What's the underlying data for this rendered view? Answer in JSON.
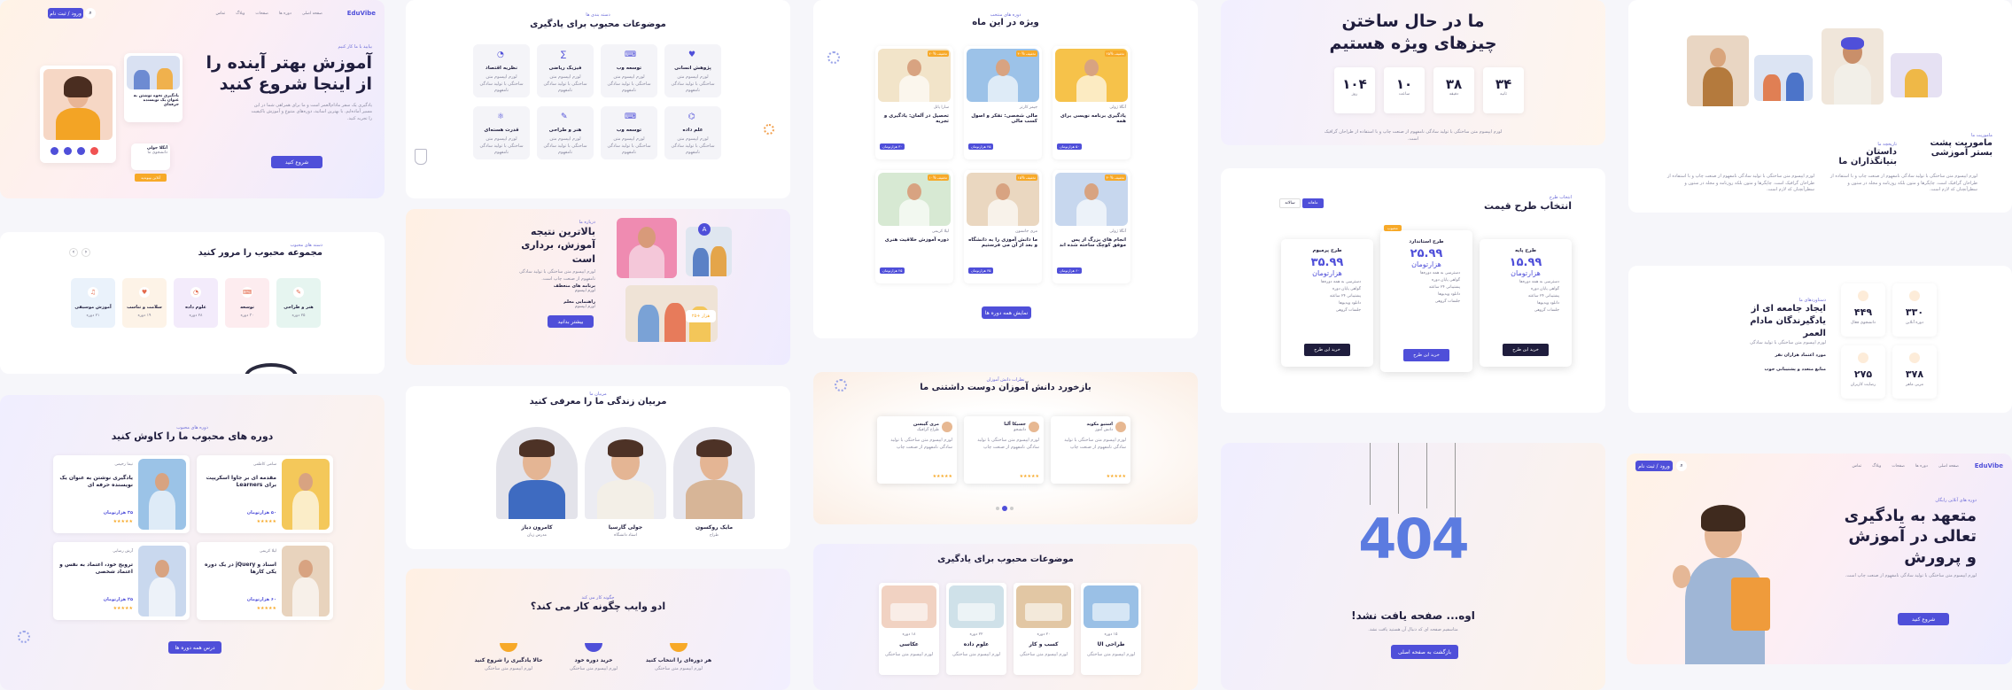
{
  "panel1": {
    "brand": "EduVibe",
    "nav": [
      "صفحه اصلی",
      "دوره ها",
      "صفحات",
      "وبلاگ",
      "تماس"
    ],
    "cta": "ورود / ثبت نام",
    "badge": "بیایید با ما کار کنیم",
    "title": "آموزش بهتر آینده را از اینجا شروع کنید",
    "desc": "یادگیری یک سفر مادام‌العمر است و ما برای همراهی شما در این مسیر آماده‌ایم. با بهترین اساتید، دوره‌های متنوع و آموزش باکیفیت را تجربه کنید.",
    "button": "شروع کنید",
    "mini_card_title": "یادگیری نحوه نوشتن به عنوان یک نویسنده حرفه‌ای",
    "person": "آنگلا جولی",
    "person_role": "دانشجوی ما",
    "join": "آنلاین بپیوندید"
  },
  "panel2": {
    "title": "موضوعات محبوب برای یادگیری",
    "subtitle": "دسته بندی ها",
    "topics": [
      "پژوهش انسانی",
      "توسعه وب",
      "فیزیک ریاضی",
      "نظریه اقتصاد",
      "علم داده",
      "توسعه وب",
      "هنر و طراحی",
      "قدرت هسته‌ای"
    ],
    "topic_desc": "لورم ایپسوم متن ساختگی با تولید سادگی نامفهوم"
  },
  "panel3": {
    "subtitle": "دوره های منتخب",
    "title": "ویژه در این ماه",
    "courses": [
      {
        "title": "یادگیری برنامه نویسی برای همه",
        "author": "آنگلا ژولی",
        "price": "۵۰ هزارتومان",
        "tag": "۲۵% تخفیف"
      },
      {
        "title": "مالی شخصی: تفکر و اصول کسب مالی",
        "author": "جیمز کارتر",
        "price": "۴۵ هزارتومان",
        "tag": "۴۰% تخفیف"
      },
      {
        "title": "تحصیل در آلمان: یادگیری و تجربه",
        "author": "سارا پاتل",
        "price": "۳۰ هزارتومان",
        "tag": "۲۰% تخفیف"
      },
      {
        "title": "انجام های بزرگ از پس موفق کوچک ساخته شده اند",
        "author": "آنگلا ژولی",
        "price": "۶۰ هزارتومان",
        "tag": "۳۰% تخفیف"
      },
      {
        "title": "ما دانش آموزی را به دانشگاه و بعد از آن می فرستیم",
        "author": "مری جانسون",
        "price": "۳۵ هزارتومان",
        "tag": "۱۵% تخفیف"
      },
      {
        "title": "دوره آموزش خلاقیت هنری",
        "author": "لیلا کریمی",
        "price": "۲۵ هزارتومان",
        "tag": "۱۰% تخفیف"
      }
    ],
    "button": "نمایش همه دوره ها"
  },
  "panel4": {
    "title": "ما در حال ساختن چیزهای ویژه هستیم",
    "countdown": [
      {
        "value": "۳۴",
        "label": "ثانیه"
      },
      {
        "value": "۳۸",
        "label": "دقیقه"
      },
      {
        "value": "۱۰",
        "label": "ساعت"
      },
      {
        "value": "۱۰۴",
        "label": "روز"
      }
    ],
    "desc": "لورم ایپسوم متن ساختگی با تولید سادگی نامفهوم از صنعت چاپ و با استفاده از طراحان گرافیک است."
  },
  "panel5": {
    "images_caption": "",
    "title1": "ماموریت پشت بستر آموزشی",
    "sub1": "ماموریت ما",
    "title2": "داستان بنیانگذاران ما",
    "sub2": "تاریخچه ما",
    "desc": "لورم ایپسوم متن ساختگی با تولید سادگی نامفهوم از صنعت چاپ و با استفاده از طراحان گرافیک است. چاپگرها و متون بلکه روزنامه و مجله در ستون و سطرآنچنان که لازم است."
  },
  "panel6": {
    "subtitle": "دسته های محبوب",
    "title": "مجموعه محبوب را مرور کنید",
    "items": [
      {
        "label": "هنر و طراحی",
        "count": "۲۵ دوره"
      },
      {
        "label": "توسعه",
        "count": "۳۰ دوره"
      },
      {
        "label": "علوم داده",
        "count": "۲۸ دوره"
      },
      {
        "label": "سلامت و تناسب",
        "count": "۱۹ دوره"
      },
      {
        "label": "آموزش موسیقی",
        "count": "۲۱ دوره"
      }
    ]
  },
  "panel7": {
    "subtitle": "درباره ما",
    "title": "بالاترین نتیجه آموزش، برداری است",
    "desc": "لورم ایپسوم متن ساختگی با تولید سادگی نامفهوم از صنعت چاپ است.",
    "f1": "برنامه های منعطف",
    "f2": "راهنمایی معلم",
    "button": "بیشتر بدانید",
    "stat": "۲۵+ هزار"
  },
  "panel8": {
    "subtitle": "انتخاب طرح",
    "title": "انتخاب طرح قیمت",
    "toggle": [
      "ماهانه",
      "سالانه"
    ],
    "plans": [
      {
        "name": "طرح پایه",
        "price": "۱۵.۹۹",
        "unit": "هزارتومان",
        "button": "خرید این طرح"
      },
      {
        "name": "طرح استاندارد",
        "price": "۲۵.۹۹",
        "unit": "هزارتومان",
        "button": "خرید این طرح",
        "tag": "محبوب"
      },
      {
        "name": "طرح پرمیوم",
        "price": "۳۵.۹۹",
        "unit": "هزارتومان",
        "button": "خرید این طرح"
      }
    ],
    "features": [
      "دسترسی به همه دوره‌ها",
      "گواهی پایان دوره",
      "پشتیبانی ۲۴ ساعته",
      "دانلود ویدیوها",
      "جلسات گروهی"
    ]
  },
  "panel9": {
    "subtitle": "دستاوردهای ما",
    "title": "ایجاد جامعه ای از یادگیرندگان مادام العمر",
    "stats": [
      {
        "value": "۳۳۰",
        "label": "دوره آنلاین"
      },
      {
        "value": "۴۴۹",
        "label": "دانشجوی فعال"
      },
      {
        "value": "۳۷۸",
        "label": "مربی ماهر"
      },
      {
        "value": "۲۷۵",
        "label": "رضایت کاربران"
      }
    ],
    "f1": "مورد اعتماد هزاران نفر",
    "f2": "منابع متعدد و پشتیبانی خوب"
  },
  "panel10": {
    "subtitle": "دوره های محبوب",
    "title": "دوره های محبوب ما را کاوش کنید",
    "courses": [
      {
        "title": "مقدمه ای بر جاوا اسکریپت برای Learners",
        "author": "سامی کاظمی",
        "price": "۵۰ هزارتومان"
      },
      {
        "title": "یادگیری نوشتن به عنوان یک نویسنده حرفه ای",
        "author": "نیما رحیمی",
        "price": "۳۵ هزارتومان"
      },
      {
        "title": "اسناد و jQuery در یک دوره یکی کارها",
        "author": "لیلا کریمی",
        "price": "۶۰ هزارتومان"
      },
      {
        "title": "ترویج خود، اعتماد به نفس و اعتماد شخصی",
        "author": "آرش رضایی",
        "price": "۲۵ هزارتومان"
      }
    ],
    "button": "درس همه دوره ها"
  },
  "panel11": {
    "subtitle": "مربیان ما",
    "title": "مربیان زندگی ما را معرفی کنید",
    "people": [
      {
        "name": "مایک روکسون",
        "role": "طراح"
      },
      {
        "name": "جولی گارسیا",
        "role": "استاد دانشگاه"
      },
      {
        "name": "کامرون دیاز",
        "role": "مدرس زبان"
      }
    ]
  },
  "panel12": {
    "subtitle": "نظرات دانش آموزان",
    "title": "بازخورد دانش آموزان دوست داشتنی ما",
    "testimonials": [
      {
        "name": "استیو مکوید",
        "role": "دانش آموز"
      },
      {
        "name": "جسیکا آلبا",
        "role": "دانشجو"
      },
      {
        "name": "مری گیبسن",
        "role": "طراح گرافیک"
      }
    ]
  },
  "panel13": {
    "title": "اوه... صفحه یافت نشد!",
    "desc": "متاسفیم صفحه ای که دنبال آن هستید یافت نشد.",
    "button": "بازگشت به صفحه اصلی",
    "code": "404"
  },
  "panel14": {
    "brand": "EduVibe",
    "nav": [
      "صفحه اصلی",
      "دوره ها",
      "صفحات",
      "وبلاگ",
      "تماس"
    ],
    "cta": "ورود / ثبت نام",
    "badge": "دوره های آنلاین رایگان",
    "title": "متعهد به یادگیری تعالی در آموزش و پرورش",
    "desc": "لورم ایپسوم متن ساختگی با تولید سادگی نامفهوم از صنعت چاپ است.",
    "button": "شروع کنید"
  },
  "panel15": {
    "subtitle": "چگونه کار می کند",
    "title": "ادو وایب چگونه کار می کند؟",
    "steps": [
      "هر دوره‌ای را انتخاب کنید",
      "خرید دوره خود",
      "حالا یادگیری را شروع کنید"
    ]
  },
  "panel16": {
    "title": "موضوعات محبوب برای یادگیری",
    "items": [
      {
        "title": "طراحی UI",
        "count": "۱۵ دوره"
      },
      {
        "title": "کسب و کار",
        "count": "۲۰ دوره"
      },
      {
        "title": "علوم داده",
        "count": "۲۲ دوره"
      },
      {
        "title": "عکاسی",
        "count": "۱۸ دوره"
      }
    ]
  }
}
